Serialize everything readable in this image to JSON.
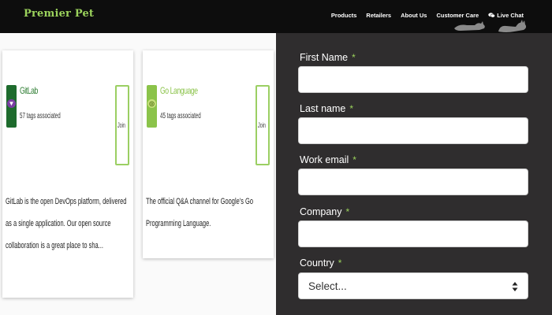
{
  "brand": {
    "name": "Premier Pet",
    "swirl": "•ₒ"
  },
  "nav": {
    "items": [
      "Products",
      "Retailers",
      "About Us",
      "Customer Care"
    ],
    "chat": "Live Chat"
  },
  "cards": [
    {
      "title": "GitLab",
      "subtitle": "57 tags associated",
      "join": "Join",
      "description": "GitLab is the open DevOps platform, delivered as a single application. Our open source collaboration is a great place to sha..."
    },
    {
      "title": "Go Language",
      "subtitle": "45 tags associated",
      "join": "Join",
      "description": "The official Q&A channel for Google's Go Programming Language."
    }
  ],
  "form": {
    "first_name": "First Name",
    "last_name": "Last name",
    "work_email": "Work email",
    "company": "Company",
    "country": "Country",
    "required_mark": "*",
    "country_placeholder": "Select..."
  },
  "colors": {
    "brand_green": "#9bd25c",
    "header_bg": "#0d0d0d",
    "form_bg": "#2f2d2e"
  }
}
